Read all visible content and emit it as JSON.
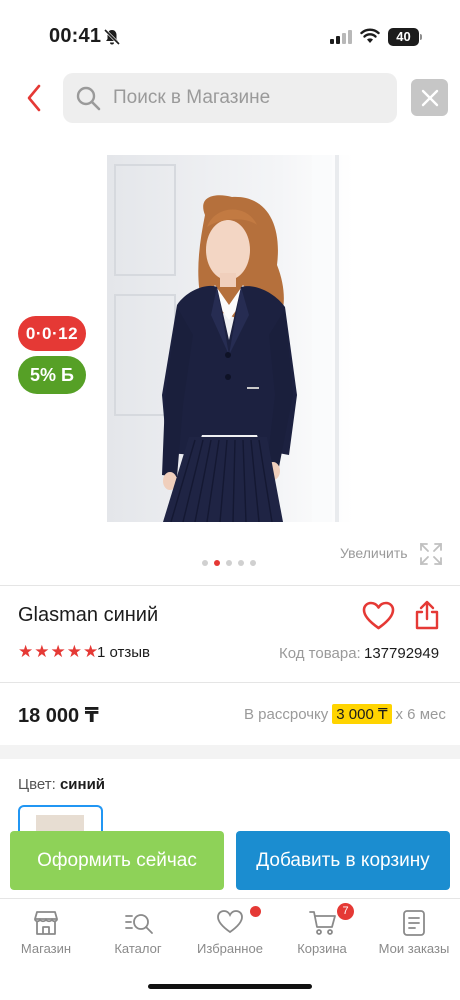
{
  "status_bar": {
    "time": "00:41",
    "battery": "40"
  },
  "search": {
    "placeholder": "Поиск в Магазине"
  },
  "product": {
    "timer_badge": "0·0·12",
    "bonus_badge": "5% Б",
    "zoom_label": "Увеличить",
    "gallery_active_index": 1,
    "gallery_count": 5,
    "title": "Glasman синий",
    "rating": 5,
    "reviews": "1 отзыв",
    "code_label": "Код товара:",
    "code_value": "137792949",
    "price": "18 000 ₸",
    "installment_prefix": "В рассрочку",
    "installment_amount": "3 000 ₸",
    "installment_suffix": "x 6 мес",
    "color_label": "Цвет:",
    "color_value": "синий"
  },
  "actions": {
    "checkout": "Оформить сейчас",
    "add_to_cart": "Добавить в корзину"
  },
  "nav": {
    "items": [
      {
        "label": "Магазин",
        "icon": "shop-icon"
      },
      {
        "label": "Каталог",
        "icon": "catalog-search-icon"
      },
      {
        "label": "Избранное",
        "icon": "heart-icon"
      },
      {
        "label": "Корзина",
        "icon": "cart-icon"
      },
      {
        "label": "Мои заказы",
        "icon": "orders-icon"
      }
    ],
    "cart_count": "7"
  },
  "colors": {
    "accent_red": "#e53935",
    "bonus_green": "#56a026",
    "checkout_green": "#8ed258",
    "cart_blue": "#1b8dd0",
    "installment_yellow": "#ffd400"
  }
}
